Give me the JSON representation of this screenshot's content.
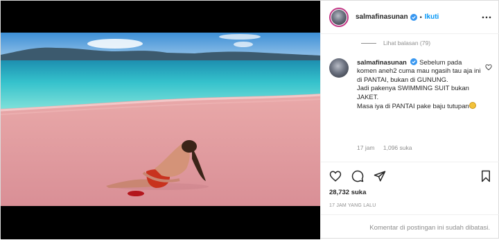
{
  "colors": {
    "accent": "#0095f6",
    "verified": "#3897f0",
    "text": "#262626",
    "muted": "#8e8e8e"
  },
  "post": {
    "username": "salmafinasunan",
    "follow_label": "Ikuti",
    "separator": "•",
    "view_replies": "Lihat balasan (79)",
    "comment": {
      "username": "salmafinasunan",
      "lines": [
        "Sebelum pada komen aneh2 cuma mau ngasih tau aja ini di PANTAI, bukan di GUNUNG.",
        "Jadi pakenya SWIMMING SUIT bukan JAKET.",
        "Masa iya di PANTAI pake baju tutupan"
      ],
      "time": "17 jam",
      "likes": "1,096 suka"
    },
    "likes": "28,732 suka",
    "time_ago": "17 JAM YANG LALU",
    "comments_closed": "Komentar di postingan ini sudah dibatasi."
  },
  "icons": {
    "verified": "verified-badge-icon",
    "more": "more-options-icon",
    "like": "heart-icon",
    "comment": "comment-icon",
    "share": "paper-plane-icon",
    "save": "bookmark-icon",
    "emoji": "embarrassed-face-emoji"
  }
}
